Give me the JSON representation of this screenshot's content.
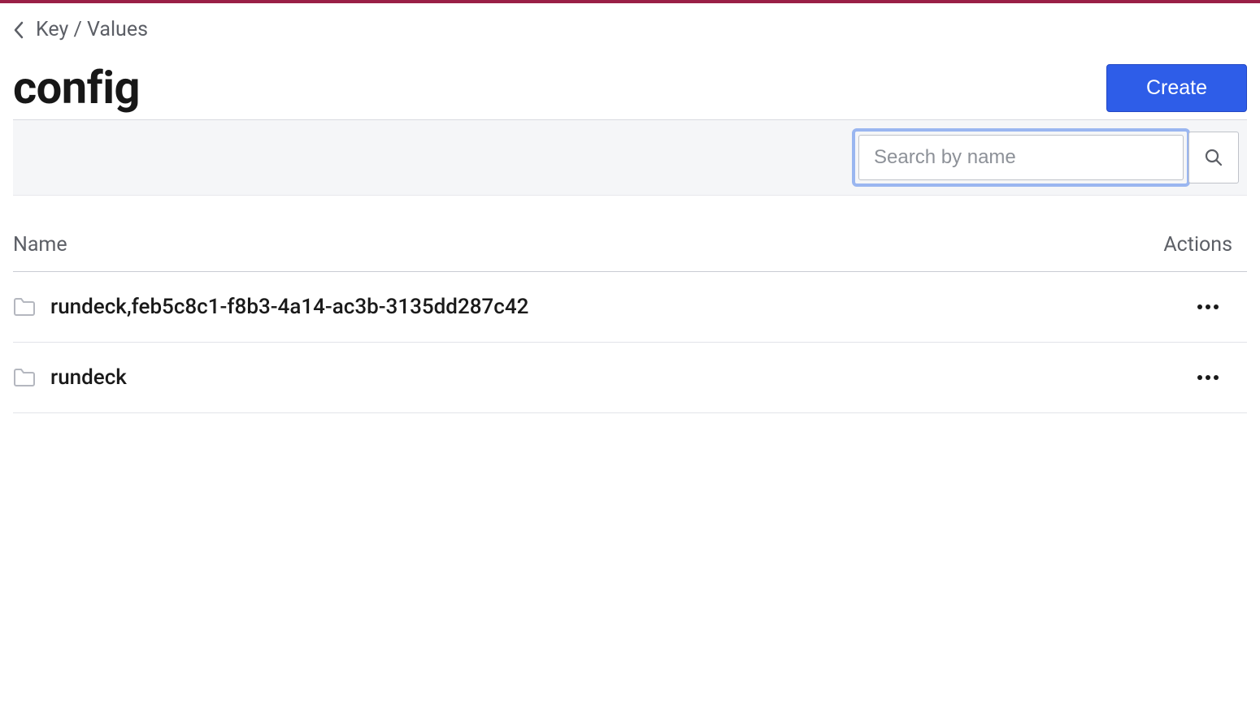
{
  "breadcrumb": {
    "label": "Key / Values"
  },
  "header": {
    "title": "config",
    "create_button": "Create"
  },
  "search": {
    "placeholder": "Search by name",
    "value": ""
  },
  "table": {
    "columns": {
      "name": "Name",
      "actions": "Actions"
    },
    "rows": [
      {
        "name": "rundeck,feb5c8c1-f8b3-4a14-ac3b-3135dd287c42"
      },
      {
        "name": "rundeck"
      }
    ]
  }
}
